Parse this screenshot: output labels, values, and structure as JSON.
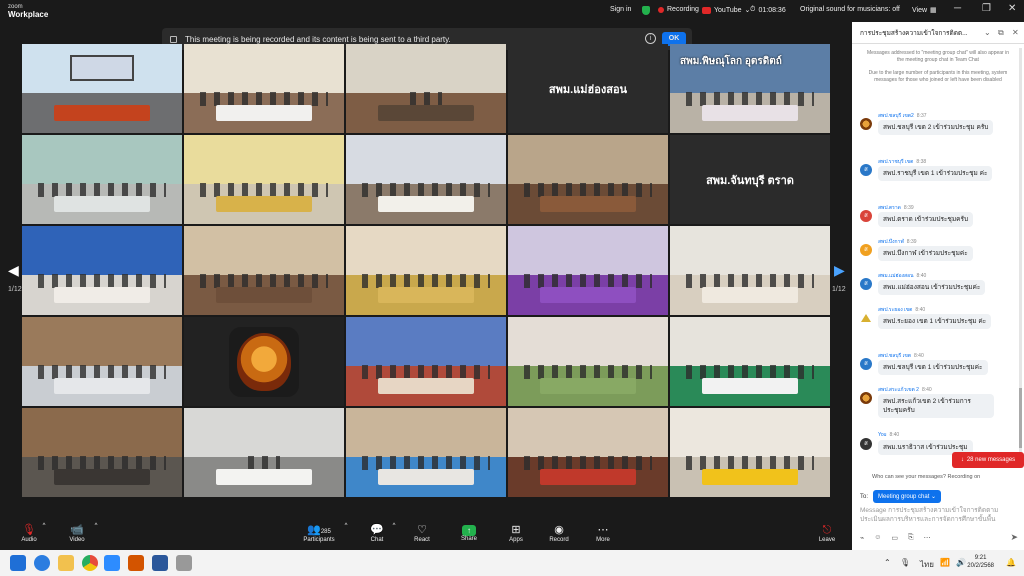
{
  "app": {
    "brand_top": "zoom",
    "brand_bottom": "Workplace"
  },
  "topbar": {
    "sign_in": "Sign in",
    "recording": "Recording",
    "youtube": "YouTube",
    "timer": "01:08:36",
    "original_sound": "Original sound for musicians: off",
    "view": "View"
  },
  "notice": {
    "text": "This meeting is being recorded and its content is being sent to a third party.",
    "ok": "OK"
  },
  "gallery": {
    "page_left": "1/12",
    "page_right": "1/12",
    "named_tiles": [
      "สพม.แม่ฮ่องสอน",
      "สพม.จันทบุรี ตราด"
    ],
    "banner_tile": "สพม.พิษณุโลก อุตรดิตถ์"
  },
  "toolbar": {
    "audio": "Audio",
    "video": "Video",
    "participants": "Participants",
    "participants_count": "285",
    "chat": "Chat",
    "react": "React",
    "share": "Share",
    "apps": "Apps",
    "record": "Record",
    "more": "More",
    "leave": "Leave"
  },
  "chat": {
    "title": "การประชุมสร้างความเข้าใจการติดต...",
    "system_note_1": "Messages addressed to \"meeting group chat\" will also appear in the meeting group chat in Team Chat",
    "system_note_2": "Due to the large number of participants in this meeting, system messages for those who joined or left have been disabled",
    "messages": [
      {
        "sender": "สพป.ชลบุรี เขต2",
        "time": "8:37",
        "text": "สพป.ชลบุรี เขต 2 เข้าร่วมประชุม ครับ",
        "avatar": "img"
      },
      {
        "sender": "สพป.ราชบุรี เขต",
        "time": "8:38",
        "text": "สพป.ราชบุรี เขต 1 เข้าร่วมประชุม ค่ะ",
        "avatar": "ส"
      },
      {
        "sender": "สพป.ตราด",
        "time": "8:39",
        "text": "สพป.ตราด เข้าร่วมประชุมครับ",
        "avatar": "ส"
      },
      {
        "sender": "สพป.บึงกาฬ",
        "time": "8:39",
        "text": "สพป.บึงกาฬ เข้าร่วมประชุมค่ะ",
        "avatar": "ส"
      },
      {
        "sender": "สพม.แม่ฮ่องสอน",
        "time": "8:40",
        "text": "สพม.แม่ฮ่องสอน เข้าร่วมประชุมค่ะ",
        "avatar": "ส"
      },
      {
        "sender": "สพป.ระยอง เขต",
        "time": "8:40",
        "text": "สพป.ระยอง เขต 1 เข้าร่วมประชุม ค่ะ",
        "avatar": "tri"
      },
      {
        "sender": "สพป.ชลบุรี เขต",
        "time": "8:40",
        "text": "สพป.ชลบุรี เขต 1 เข้าร่วมประชุมค่ะ",
        "avatar": "ส"
      },
      {
        "sender": "สพป.สระแก้วเขต 2",
        "time": "8:40",
        "text": "สพป.สระแก้วเขต 2 เข้าร่วมการ ประชุมครับ",
        "avatar": "img"
      },
      {
        "sender": "You",
        "time": "8:40",
        "text": "สพม.นราธิวาส เข้าร่วมประชุม",
        "avatar": "ส"
      }
    ],
    "new_messages": "28 new messages",
    "who_can_see": "Who can see your messages? Recording on",
    "to_label": "To:",
    "to_target": "Meeting group chat",
    "compose_placeholder": "Message การประชุมสร้างความเข้าใจการติดตามประเมินผลการบริหารและการจัดการศึกษาขั้นพื้น"
  },
  "taskbar": {
    "lang": "ไทย",
    "time": "9:21",
    "date": "20/2/2568"
  }
}
